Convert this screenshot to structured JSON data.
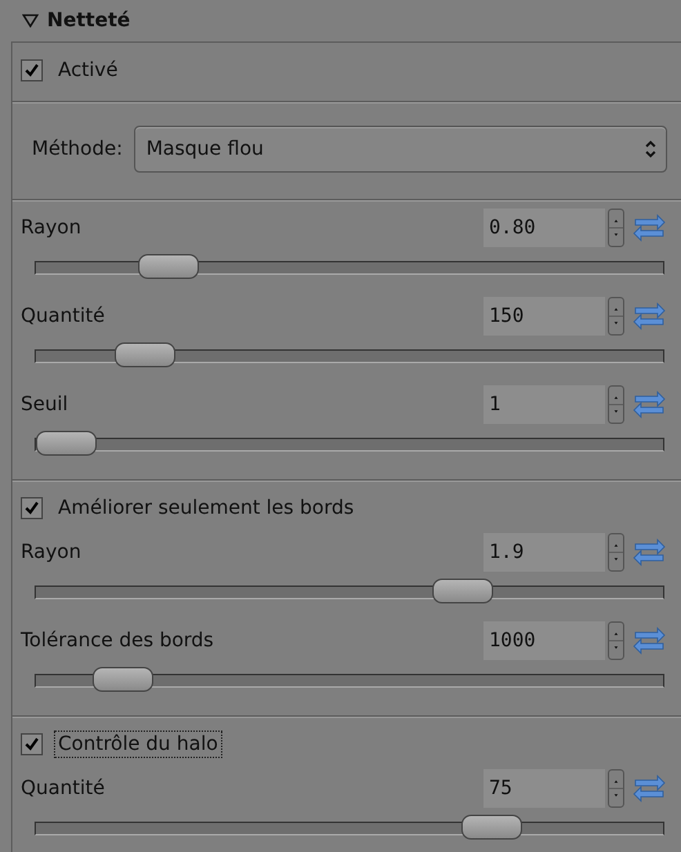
{
  "header": {
    "title": "Netteté",
    "expanded": true
  },
  "sections": [
    {
      "items": [
        {
          "kind": "checkbox",
          "label": "Activé",
          "checked": true,
          "focused": false
        }
      ]
    },
    {
      "items": [
        {
          "kind": "select",
          "label": "Méthode:",
          "value": "Masque flou"
        }
      ]
    },
    {
      "items": [
        {
          "kind": "slider",
          "label": "Rayon",
          "value": "0.80",
          "level": 0.18
        },
        {
          "kind": "slider",
          "label": "Quantité",
          "value": "150",
          "level": 0.14
        },
        {
          "kind": "slider",
          "label": "Seuil",
          "value": "1",
          "level": 0
        }
      ]
    },
    {
      "items": [
        {
          "kind": "checkbox",
          "label": "Améliorer seulement les bords",
          "checked": true,
          "focused": false
        },
        {
          "kind": "slider",
          "label": "Rayon",
          "value": "1.9",
          "level": 0.7
        },
        {
          "kind": "slider",
          "label": "Tolérance des bords",
          "value": "1000",
          "level": 0.1
        }
      ]
    },
    {
      "items": [
        {
          "kind": "checkbox",
          "label": "Contrôle du halo",
          "checked": true,
          "focused": true
        },
        {
          "kind": "slider",
          "label": "Quantité",
          "value": "75",
          "level": 0.75
        }
      ]
    }
  ]
}
